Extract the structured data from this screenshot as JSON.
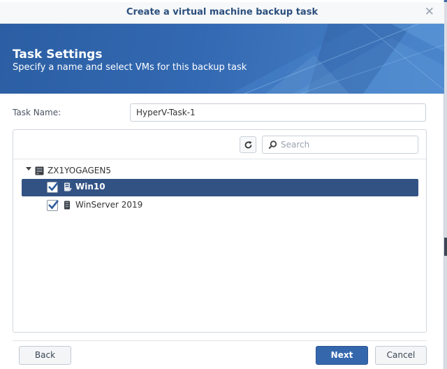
{
  "window": {
    "title": "Create a virtual machine backup task",
    "close_icon": "close-icon"
  },
  "banner": {
    "title": "Task Settings",
    "subtitle": "Specify a name and select VMs for this backup task"
  },
  "form": {
    "task_name_label": "Task Name:",
    "task_name_value": "HyperV-Task-1"
  },
  "toolbar": {
    "refresh_icon": "refresh-icon",
    "search_placeholder": "Search",
    "search_icon": "search-icon"
  },
  "tree": {
    "host": {
      "label": "ZX1YOGAGEN5",
      "icon": "server-icon",
      "expanded": true
    },
    "vms": [
      {
        "label": "Win10",
        "checked": true,
        "selected": true,
        "icon": "vm-icon"
      },
      {
        "label": "WinServer 2019",
        "checked": true,
        "selected": false,
        "icon": "vm-icon"
      }
    ]
  },
  "footer": {
    "back_label": "Back",
    "next_label": "Next",
    "cancel_label": "Cancel"
  },
  "colors": {
    "accent": "#3567ad",
    "selected_row": "#325284",
    "title_text": "#2c4f7c"
  }
}
